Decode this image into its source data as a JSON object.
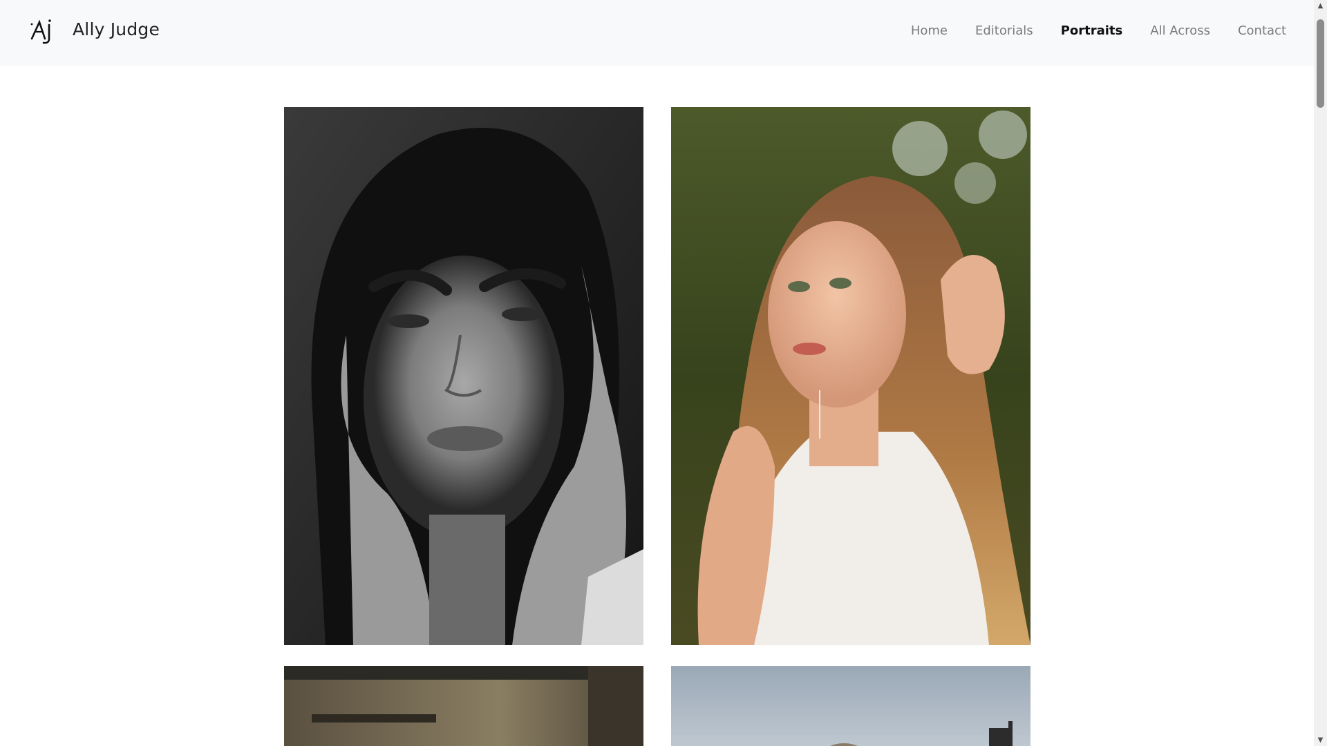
{
  "header": {
    "brand_name": "Ally Judge",
    "logo_text": "AJ"
  },
  "nav": {
    "items": [
      {
        "label": "Home",
        "active": false
      },
      {
        "label": "Editorials",
        "active": false
      },
      {
        "label": "Portraits",
        "active": true
      },
      {
        "label": "All Across",
        "active": false
      },
      {
        "label": "Contact",
        "active": false
      }
    ]
  },
  "gallery": {
    "photos": [
      {
        "description_icon": "portrait-bw-photo"
      },
      {
        "description_icon": "portrait-outdoor-photo"
      },
      {
        "description_icon": "portrait-indoor-photo"
      },
      {
        "description_icon": "portrait-sky-photo"
      }
    ]
  },
  "colors": {
    "header_bg": "#f8f9fa",
    "nav_inactive": "#7a7a7a",
    "nav_active": "#111111"
  }
}
